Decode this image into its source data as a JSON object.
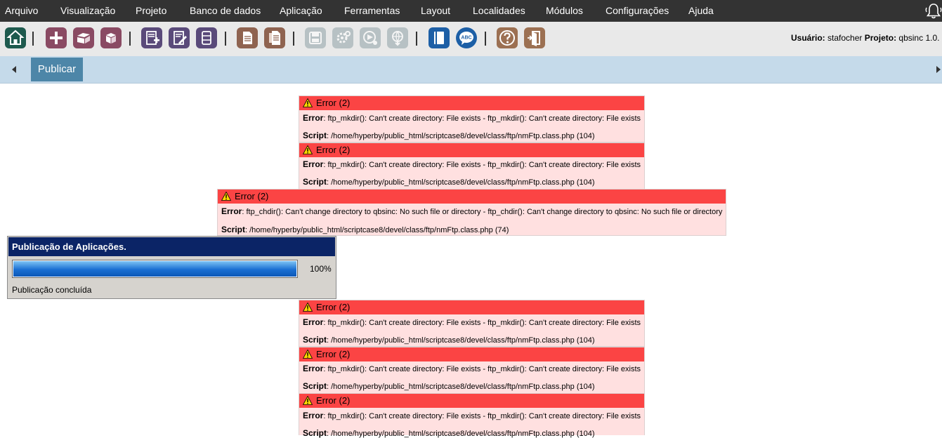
{
  "menu": [
    {
      "label": "Arquivo"
    },
    {
      "label": "Visualização"
    },
    {
      "label": "Projeto"
    },
    {
      "label": "Banco de dados"
    },
    {
      "label": "Aplicação"
    },
    {
      "label": "Ferramentas"
    },
    {
      "label": "Layout"
    },
    {
      "label": "Localidades"
    },
    {
      "label": "Módulos"
    },
    {
      "label": "Configurações"
    },
    {
      "label": "Ajuda"
    }
  ],
  "toolbar": {
    "icons": [
      "home-icon",
      "add-icon",
      "open-project-icon",
      "box-icon",
      "new-application-icon",
      "edit-application-icon",
      "database-icon",
      "document-icon",
      "documents-icon",
      "save-icon",
      "settings-icon",
      "run-icon",
      "publish-icon",
      "book-icon",
      "spellcheck-icon",
      "help-icon",
      "exit-icon"
    ],
    "user_label": "Usuário:",
    "user": "stafocher",
    "project_label": "Projeto:",
    "project": "qbsinc",
    "version": "1.0."
  },
  "tabs": [
    {
      "label": "Publicar"
    }
  ],
  "errors": [
    {
      "title": "Error (2)",
      "error_label": "Error",
      "message": ": ftp_mkdir(): Can't create directory: File exists - ftp_mkdir(): Can't create directory: File exists",
      "script_label": "Script",
      "script": ": /home/hyperby/public_html/scriptcase8/devel/class/ftp/nmFtp.class.php (104)"
    },
    {
      "title": "Error (2)",
      "error_label": "Error",
      "message": ": ftp_mkdir(): Can't create directory: File exists - ftp_mkdir(): Can't create directory: File exists",
      "script_label": "Script",
      "script": ": /home/hyperby/public_html/scriptcase8/devel/class/ftp/nmFtp.class.php (104)"
    },
    {
      "title": "Error (2)",
      "error_label": "Error",
      "message": ": ftp_chdir(): Can't change directory to qbsinc: No such file or directory - ftp_chdir(): Can't change directory to qbsinc: No such file or directory",
      "script_label": "Script",
      "script": ": /home/hyperby/public_html/scriptcase8/devel/class/ftp/nmFtp.class.php (74)"
    },
    {
      "title": "Error (2)",
      "error_label": "Error",
      "message": ": ftp_mkdir(): Can't create directory: File exists - ftp_mkdir(): Can't create directory: File exists",
      "script_label": "Script",
      "script": ": /home/hyperby/public_html/scriptcase8/devel/class/ftp/nmFtp.class.php (104)"
    },
    {
      "title": "Error (2)",
      "error_label": "Error",
      "message": ": ftp_mkdir(): Can't create directory: File exists - ftp_mkdir(): Can't create directory: File exists",
      "script_label": "Script",
      "script": ": /home/hyperby/public_html/scriptcase8/devel/class/ftp/nmFtp.class.php (104)"
    },
    {
      "title": "Error (2)",
      "error_label": "Error",
      "message": ": ftp_mkdir(): Can't create directory: File exists - ftp_mkdir(): Can't create directory: File exists",
      "script_label": "Script",
      "script": ": /home/hyperby/public_html/scriptcase8/devel/class/ftp/nmFtp.class.php (104)"
    }
  ],
  "publish": {
    "title": "Publicação de Aplicações.",
    "progress": 100,
    "percent_label": "100%",
    "status": "Publicação concluída"
  },
  "colors": {
    "menubar": "#333333",
    "error_header": "#fb4444",
    "error_body": "#ffe0e0",
    "tab_active": "#4d86a8",
    "panel_header": "#0b2466"
  }
}
